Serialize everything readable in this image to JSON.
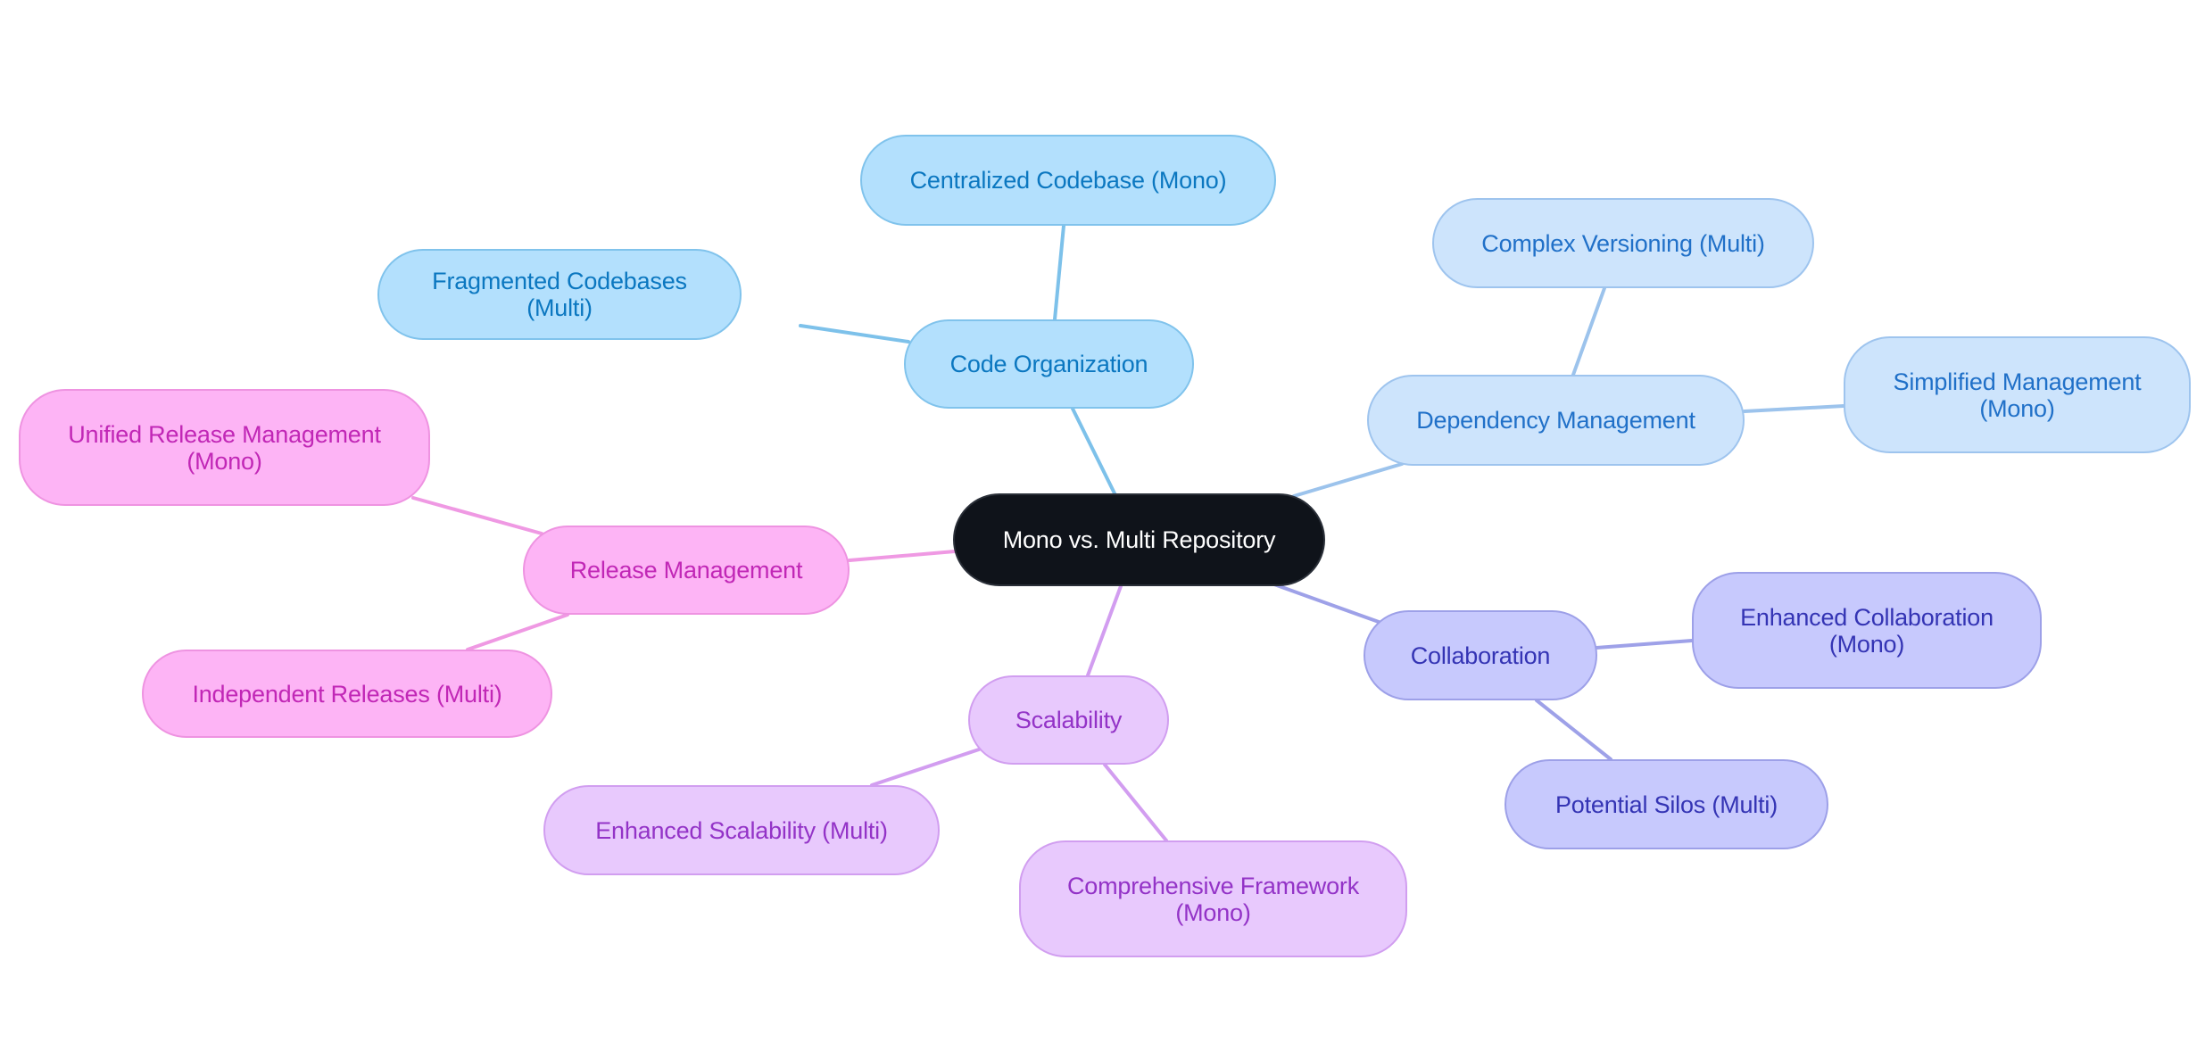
{
  "diagram": {
    "type": "mind-map",
    "root": {
      "id": "root",
      "label": "Mono vs. Multi Repository"
    },
    "branches": [
      {
        "id": "code-organization",
        "label": "Code Organization",
        "color": {
          "fill": "#b3e0fd",
          "border": "#80c3ec",
          "text": "#0b77c0",
          "line": "#7dc1ea"
        },
        "children": [
          {
            "id": "centralized-codebase",
            "label": "Centralized Codebase (Mono)"
          },
          {
            "id": "fragmented-codebases",
            "label": "Fragmented Codebases (Multi)"
          }
        ]
      },
      {
        "id": "dependency-management",
        "label": "Dependency Management",
        "color": {
          "fill": "#cde4fc",
          "border": "#9ec4ee",
          "text": "#2070c8",
          "line": "#9cc3ec"
        },
        "children": [
          {
            "id": "complex-versioning",
            "label": "Complex Versioning (Multi)"
          },
          {
            "id": "simplified-management",
            "label": "Simplified Management\n(Mono)"
          }
        ]
      },
      {
        "id": "collaboration",
        "label": "Collaboration",
        "color": {
          "fill": "#c7c9fd",
          "border": "#9da0e8",
          "text": "#3434b4",
          "line": "#9ea1e8"
        },
        "children": [
          {
            "id": "enhanced-collaboration",
            "label": "Enhanced Collaboration\n(Mono)"
          },
          {
            "id": "potential-silos",
            "label": "Potential Silos (Multi)"
          }
        ]
      },
      {
        "id": "scalability",
        "label": "Scalability",
        "color": {
          "fill": "#e8c9fd",
          "border": "#d19ef0",
          "text": "#9333c7",
          "line": "#d29df0"
        },
        "children": [
          {
            "id": "enhanced-scalability",
            "label": "Enhanced Scalability (Multi)"
          },
          {
            "id": "comprehensive-framework",
            "label": "Comprehensive Framework\n(Mono)"
          }
        ]
      },
      {
        "id": "release-management",
        "label": "Release Management",
        "color": {
          "fill": "#fdb4f5",
          "border": "#ee93e1",
          "text": "#c127b6",
          "line": "#ef99e3"
        },
        "children": [
          {
            "id": "unified-release-management",
            "label": "Unified Release Management\n(Mono)"
          },
          {
            "id": "independent-releases",
            "label": "Independent Releases (Multi)"
          }
        ]
      }
    ]
  }
}
